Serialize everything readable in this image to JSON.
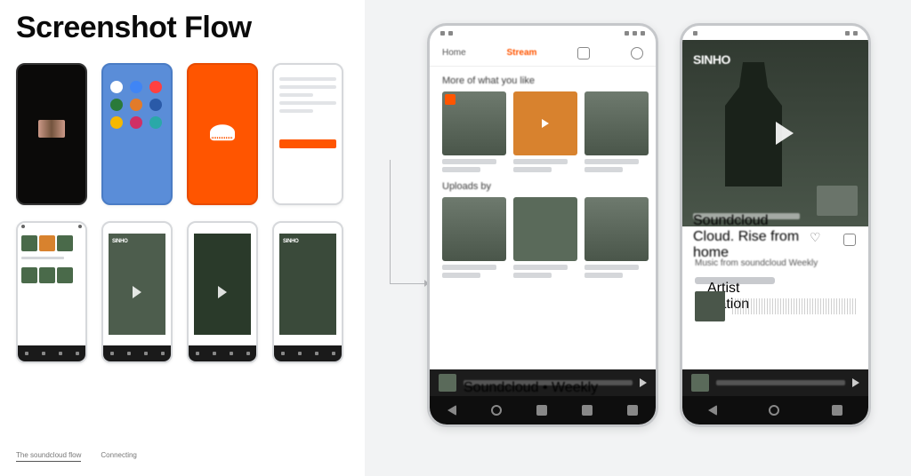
{
  "title": "Screenshot Flow",
  "left": {
    "footer": {
      "label1": "The soundcloud flow",
      "label2": "Connecting"
    }
  },
  "big_left": {
    "tab_home": "Home",
    "tab_stream": "Stream",
    "section1": "More of what you like",
    "section2": "Uploads by",
    "nowplaying": "Soundcloud • Weekly"
  },
  "big_right": {
    "brand": "SINHO",
    "caption": "Soundcloud Cloud. Rise from home",
    "detail_title": "Music from soundcloud Weekly",
    "detail_artist": "Artist station"
  }
}
